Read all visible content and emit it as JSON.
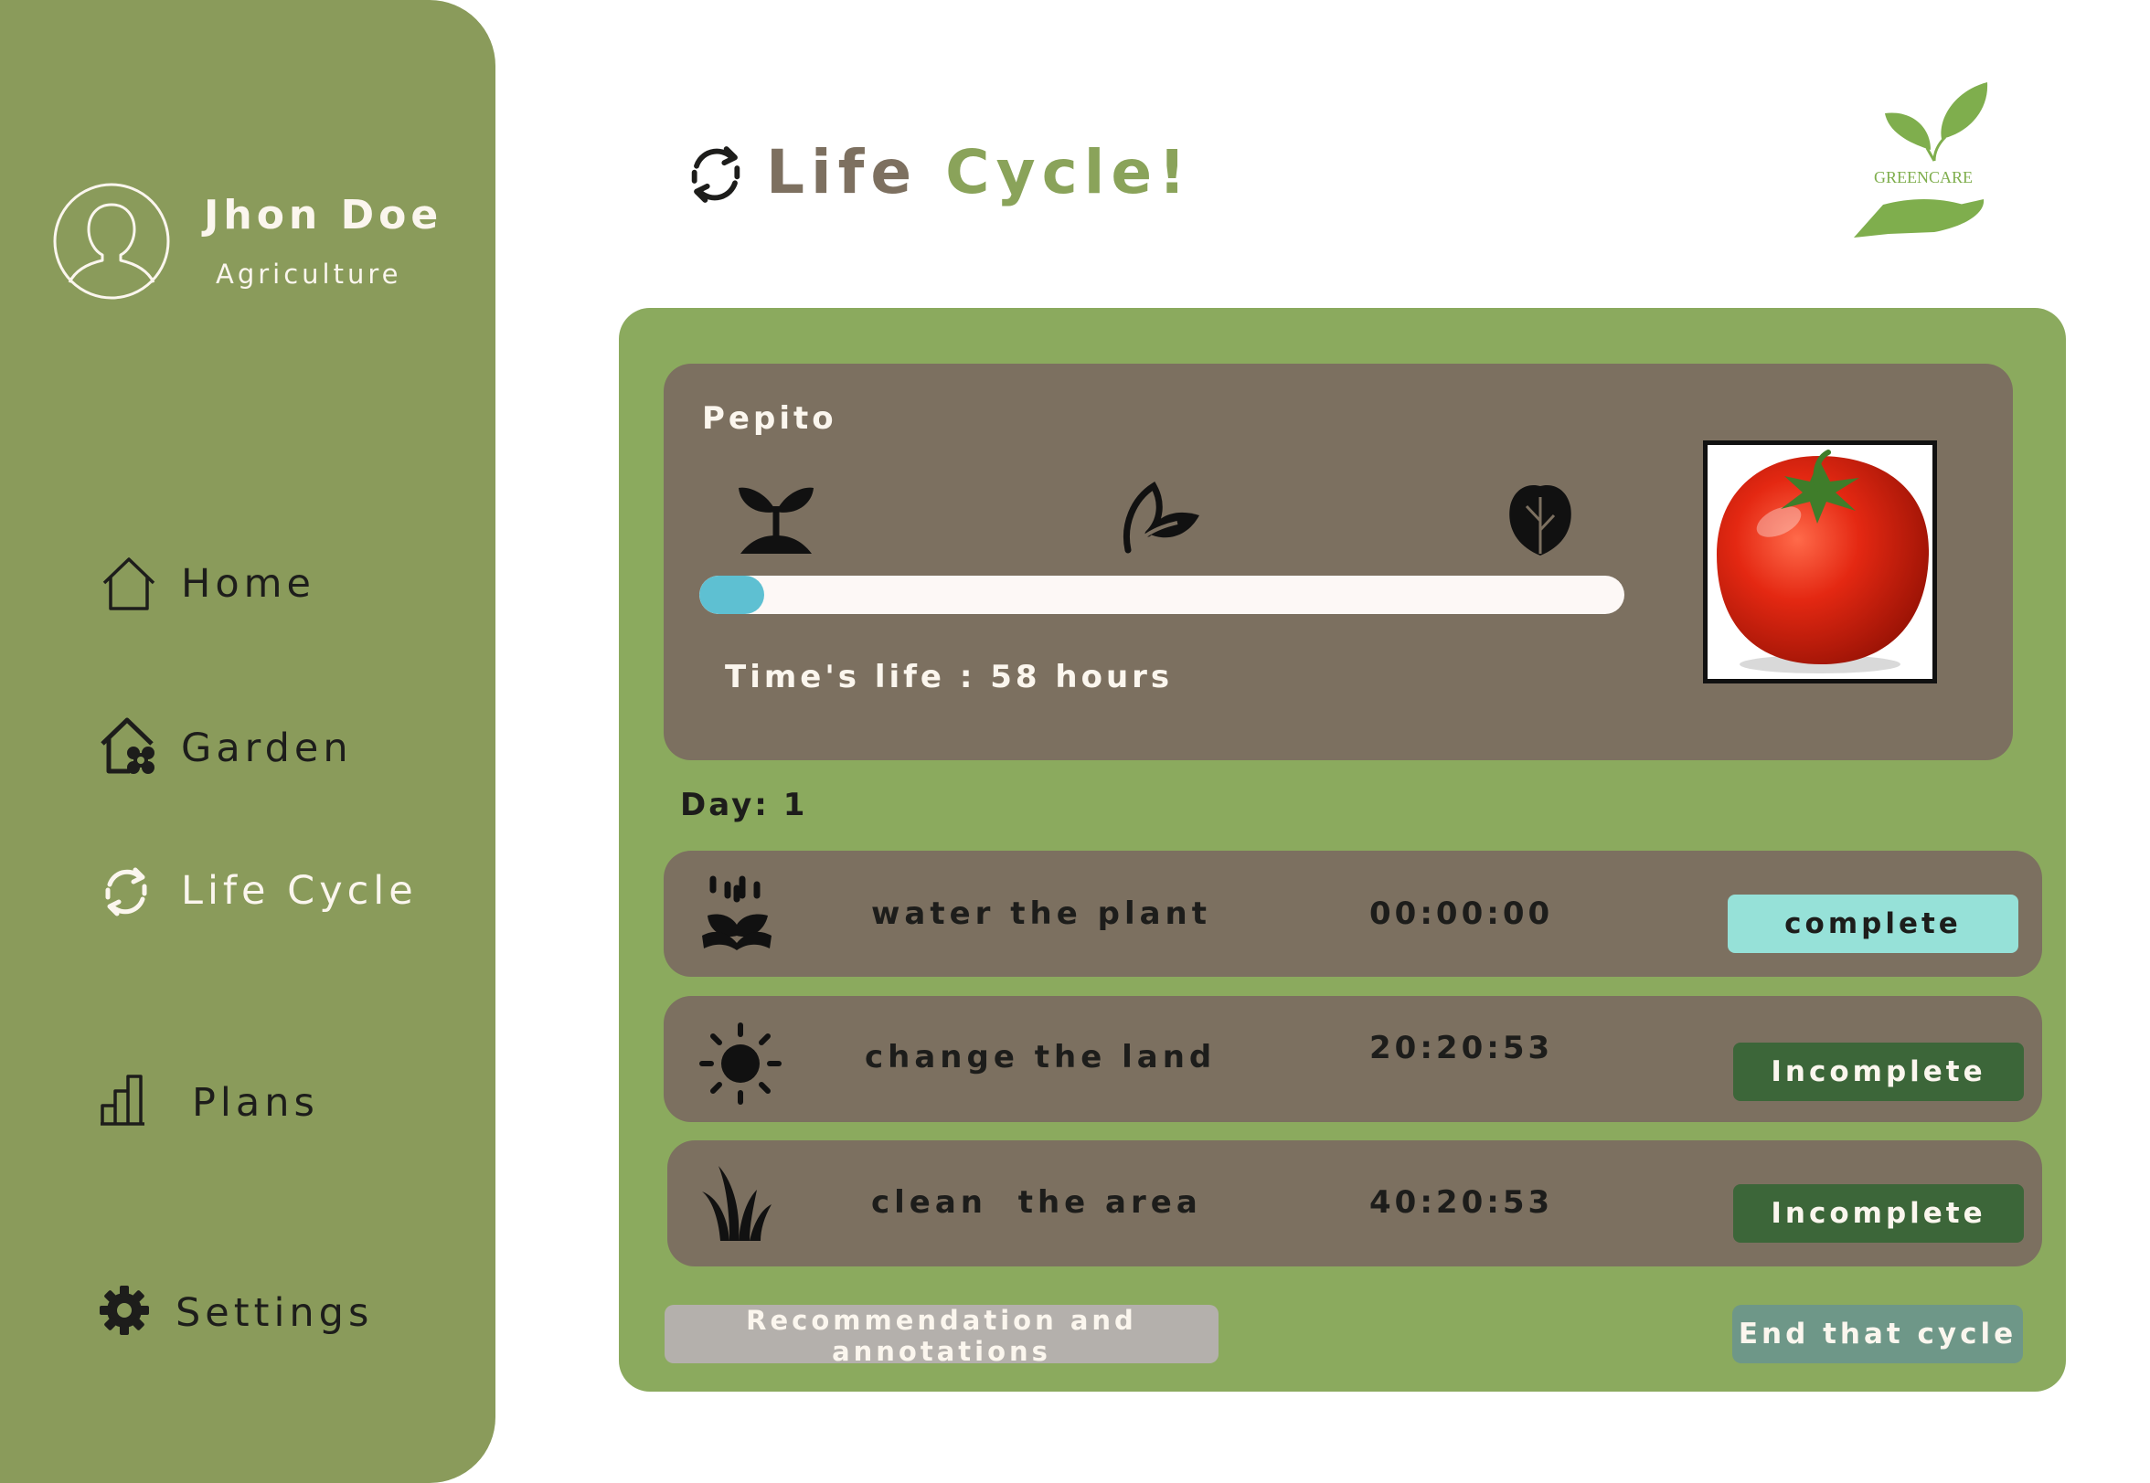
{
  "user": {
    "name": "Jhon Doe",
    "role": "Agriculture"
  },
  "sidebar": {
    "items": [
      {
        "label": "Home",
        "icon": "home-icon"
      },
      {
        "label": "Garden",
        "icon": "garden-house-icon"
      },
      {
        "label": "Life Cycle",
        "icon": "recycle-icon"
      },
      {
        "label": "Plans",
        "icon": "bar-chart-icon"
      },
      {
        "label": "Settings",
        "icon": "gear-icon"
      }
    ]
  },
  "header": {
    "title_part1": "Life",
    "title_part2": "Cycle!",
    "logo_text": "GREENCARE"
  },
  "plant": {
    "name": "Pepito",
    "progress": 0.07,
    "time_life": "Time's life : 58 hours",
    "stages": [
      "sprout-icon",
      "leaf-icon",
      "lettuce-icon"
    ]
  },
  "day": {
    "label": "Day: 1"
  },
  "tasks": [
    {
      "name": "water the plant",
      "time": "00:00:00",
      "status": "complete",
      "icon": "watering-hand-icon"
    },
    {
      "name": "change the land",
      "time": "20:20:53",
      "status": "Incomplete",
      "icon": "sun-icon"
    },
    {
      "name": "clean  the area",
      "time": "40:20:53",
      "status": "Incomplete",
      "icon": "grass-icon"
    }
  ],
  "actions": {
    "recommend_label": "Recommendation and annotations",
    "end_cycle_label": "End that cycle"
  },
  "colors": {
    "sidebar": "#8a9b5b",
    "card": "#8baa5e",
    "panel": "#7c7060",
    "progress": "#5ec0d2",
    "complete": "#96e1d8",
    "incomplete": "#3c6639"
  }
}
